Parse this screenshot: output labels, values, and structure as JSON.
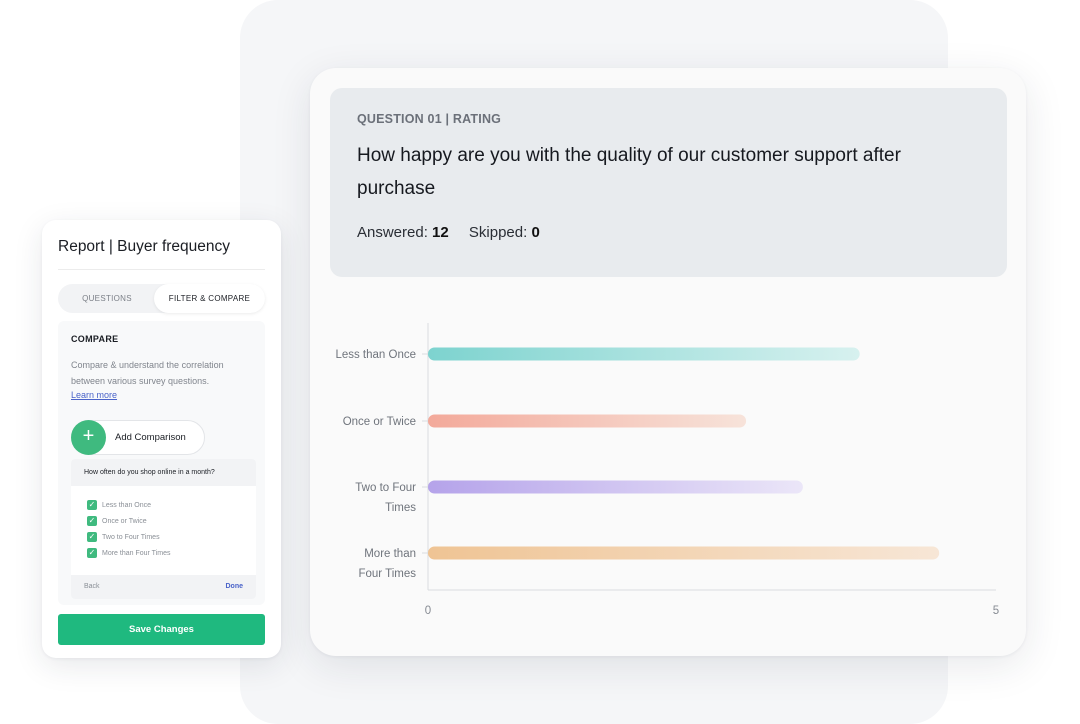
{
  "main": {
    "question_tag": "QUESTION 01 | RATING",
    "question_title": "How happy are you with the quality of our customer support after purchase",
    "answered_label": "Answered:",
    "answered_value": "12",
    "skipped_label": "Skipped:",
    "skipped_value": "0"
  },
  "chart_data": {
    "type": "bar",
    "orientation": "horizontal",
    "categories": [
      "Less than Once",
      "Once or Twice",
      "Two to Four Times",
      "More than Four Times"
    ],
    "category_lines": [
      [
        "Less than Once"
      ],
      [
        "Once or Twice"
      ],
      [
        "Two to Four",
        "Times"
      ],
      [
        "More than",
        "Four Times"
      ]
    ],
    "values": [
      3.8,
      2.8,
      3.3,
      4.5
    ],
    "xlim": [
      0,
      5
    ],
    "xticks": [
      "0",
      "5"
    ],
    "bar_colors": [
      [
        "#7dd3cf",
        "#d7f1ef"
      ],
      [
        "#f3a99a",
        "#f7e3da"
      ],
      [
        "#b5a3ea",
        "#ebe6f8"
      ],
      [
        "#efc494",
        "#f7e6d6"
      ]
    ],
    "grid": false
  },
  "side": {
    "title": "Report | Buyer frequency",
    "tab_questions": "QUESTIONS",
    "tab_filter": "FILTER & COMPARE",
    "compare_title": "COMPARE",
    "compare_desc": "Compare & understand the correlation between various survey questions.",
    "learn_more": "Learn more",
    "add_comparison": "Add Comparison",
    "dropdown_question": "How often do you shop online in a month?",
    "options": [
      "Less than Once",
      "Once or Twice",
      "Two to Four Times",
      "More than Four Times"
    ],
    "back": "Back",
    "done": "Done",
    "save": "Save Changes"
  },
  "colors": {
    "accent_green": "#1fb97f",
    "link_blue": "#4a63c9",
    "header_bg": "#e8ebee"
  }
}
